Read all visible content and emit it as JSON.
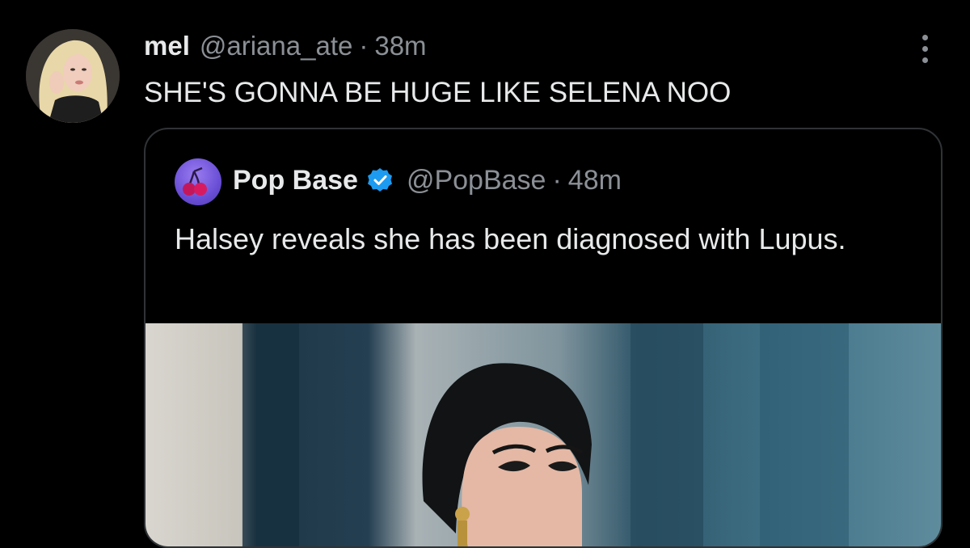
{
  "tweet": {
    "display_name": "mel",
    "handle": "@ariana_ate",
    "separator": "·",
    "time": "38m",
    "text": "SHE'S GONNA BE HUGE LIKE SELENA NOO",
    "avatar_icon": "profile-photo",
    "more_icon": "more-options-icon"
  },
  "quote": {
    "display_name": "Pop Base",
    "verified_color": "#1d9bf0",
    "handle": "@PopBase",
    "separator": "·",
    "time": "48m",
    "text": "Halsey reveals she has been diagnosed with Lupus.",
    "avatar_icon": "cherry-logo",
    "media_icon": "quoted-photo"
  },
  "colors": {
    "background": "#000000",
    "text_primary": "#e7e9ea",
    "text_secondary": "#8b9096",
    "border": "#2f3336"
  }
}
